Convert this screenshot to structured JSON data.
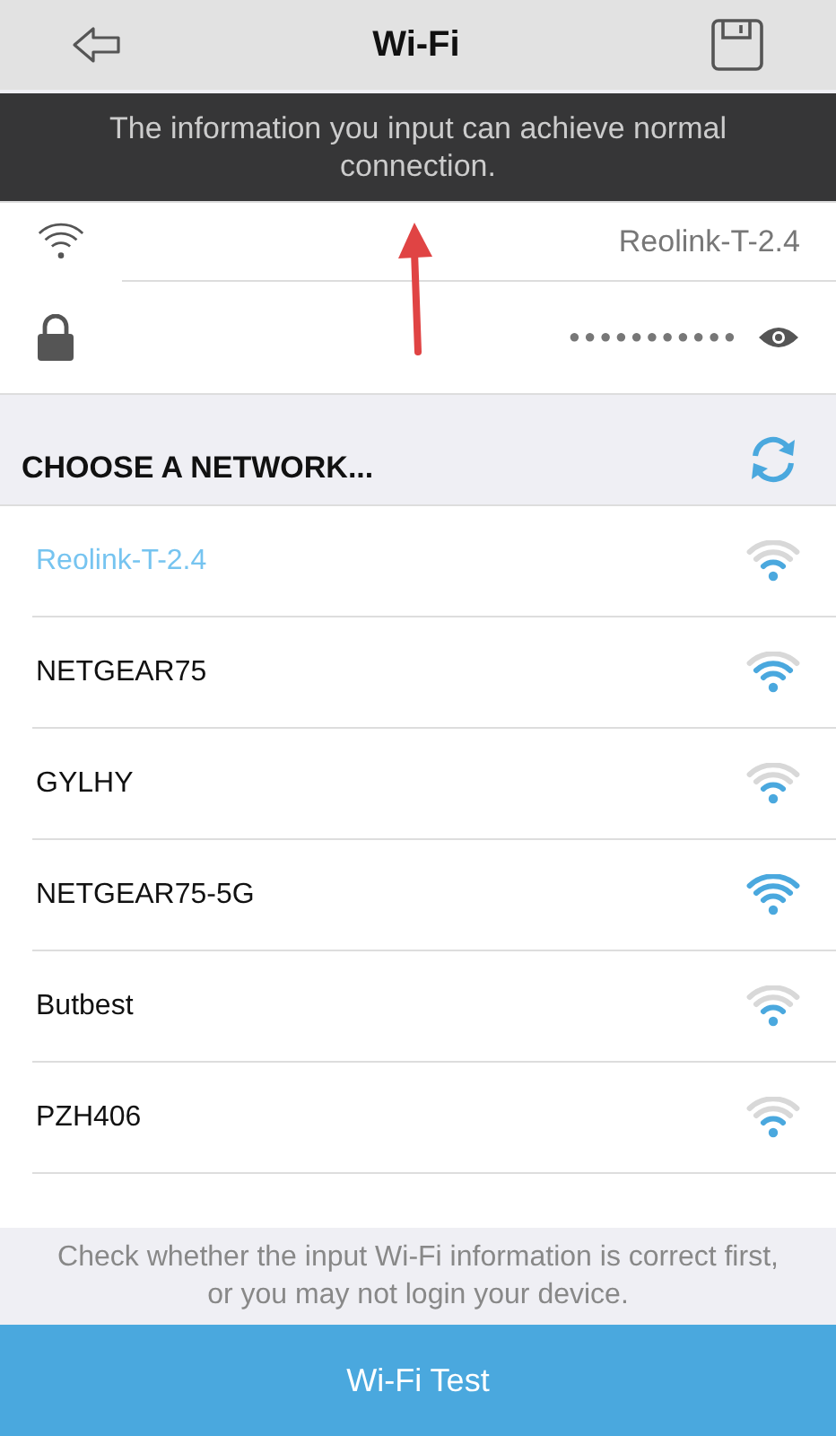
{
  "nav": {
    "title": "Wi-Fi"
  },
  "toast": {
    "text": "The information you input can achieve normal connection."
  },
  "annotation": {
    "kind": "arrow"
  },
  "current": {
    "ssid": "Reolink-T-2.4",
    "password_mask": "●●●●●●●●●●●"
  },
  "networks_header": {
    "title": "CHOOSE A NETWORK..."
  },
  "networks": [
    {
      "name": "Reolink-T-2.4",
      "kind": "weak",
      "selected": true
    },
    {
      "name": "NETGEAR75",
      "kind": "fair",
      "selected": false
    },
    {
      "name": "GYLHY",
      "kind": "weak",
      "selected": false
    },
    {
      "name": "NETGEAR75-5G",
      "kind": "strong",
      "selected": false
    },
    {
      "name": "Butbest",
      "kind": "weak",
      "selected": false
    },
    {
      "name": "PZH406",
      "kind": "weak",
      "selected": false
    }
  ],
  "hint": "Check whether the input Wi-Fi information is correct first, or you may not login your device.",
  "test_button": "Wi-Fi Test"
}
